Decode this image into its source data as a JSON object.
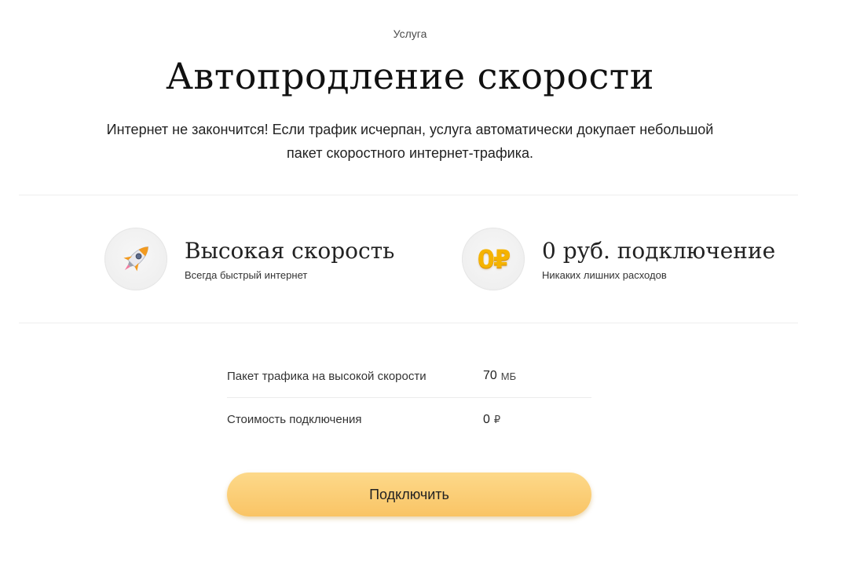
{
  "header": {
    "eyebrow": "Услуга",
    "title": "Автопродление скорости",
    "description": "Интернет не закончится! Если трафик исчерпан, услуга автоматически докупает небольшой пакет скоростного интернет-трафика."
  },
  "features": [
    {
      "icon": "rocket-icon",
      "title": "Высокая скорость",
      "subtitle": "Всегда быстрый интернет"
    },
    {
      "icon": "zero-ruble-icon",
      "icon_text": "0₽",
      "title": "0 руб. подключение",
      "subtitle": "Никаких лишних расходов"
    }
  ],
  "specs": [
    {
      "label": "Пакет трафика на высокой скорости",
      "value": "70",
      "unit": "МБ"
    },
    {
      "label": "Стоимость подключения",
      "value": "0",
      "unit": "₽"
    }
  ],
  "cta": {
    "label": "Подключить"
  },
  "colors": {
    "cta": "#f9c465",
    "ruble_badge": "#f5b300",
    "divider": "#eeeeee"
  }
}
